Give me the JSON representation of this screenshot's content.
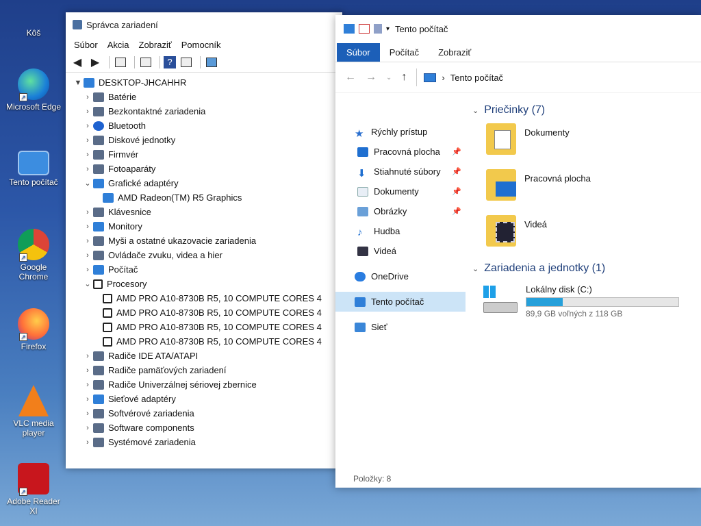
{
  "desktop": {
    "icons": [
      {
        "label": "Kôš"
      },
      {
        "label": "Microsoft Edge"
      },
      {
        "label": "Tento počítač"
      },
      {
        "label": "Google Chrome"
      },
      {
        "label": "Firefox"
      },
      {
        "label": "VLC media player"
      },
      {
        "label": "Adobe Reader XI"
      }
    ]
  },
  "device_manager": {
    "title": "Správca zariadení",
    "menu": [
      "Súbor",
      "Akcia",
      "Zobraziť",
      "Pomocník"
    ],
    "root": "DESKTOP-JHCAHHR",
    "categories": [
      "Batérie",
      "Bezkontaktné zariadenia",
      "Bluetooth",
      "Diskové jednotky",
      "Firmvér",
      "Fotoaparáty",
      "Grafické adaptéry",
      "Klávesnice",
      "Monitory",
      "Myši a ostatné ukazovacie zariadenia",
      "Ovládače zvuku, videa a hier",
      "Počítač",
      "Procesory",
      "Radiče IDE ATA/ATAPI",
      "Radiče pamäťových zariadení",
      "Radiče Univerzálnej sériovej zbernice",
      "Sieťové adaptéry",
      "Softvérové zariadenia",
      "Software components",
      "Systémové zariadenia"
    ],
    "graphics_child": "AMD Radeon(TM) R5 Graphics",
    "cpu_child": "AMD PRO A10-8730B R5, 10 COMPUTE CORES 4"
  },
  "explorer": {
    "title": "Tento počítač",
    "tabs": [
      "Súbor",
      "Počítač",
      "Zobraziť"
    ],
    "address": "Tento počítač",
    "nav": {
      "quick_access": "Rýchly prístup",
      "items": [
        "Pracovná plocha",
        "Stiahnuté súbory",
        "Dokumenty",
        "Obrázky",
        "Hudba",
        "Videá"
      ],
      "onedrive": "OneDrive",
      "this_pc": "Tento počítač",
      "network": "Sieť"
    },
    "folders_header": "Priečinky (7)",
    "folders": [
      "Dokumenty",
      "Pracovná plocha",
      "Videá"
    ],
    "devices_header": "Zariadenia a jednotky (1)",
    "drive": {
      "name": "Lokálny disk (C:)",
      "free_text": "89,9 GB voľných z 118 GB",
      "used_fraction": 0.24
    },
    "status": "Položky: 8"
  }
}
